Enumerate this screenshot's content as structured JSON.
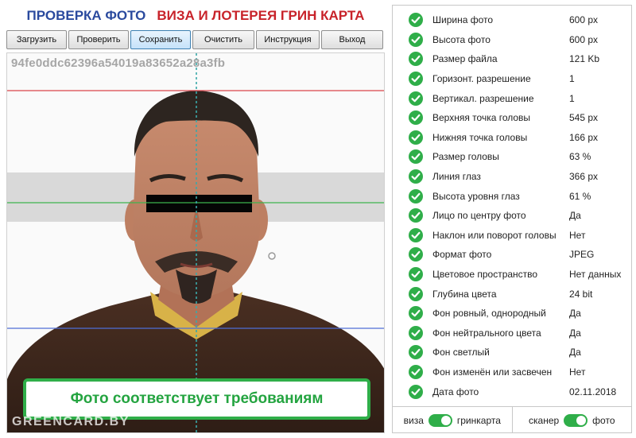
{
  "header": {
    "title_left": "ПРОВЕРКА ФОТО",
    "title_right": "ВИЗА И ЛОТЕРЕЯ ГРИН КАРТА"
  },
  "toolbar": {
    "buttons": [
      {
        "label": "Загрузить"
      },
      {
        "label": "Проверить"
      },
      {
        "label": "Сохранить"
      },
      {
        "label": "Очистить"
      },
      {
        "label": "Инструкция"
      },
      {
        "label": "Выход"
      }
    ],
    "active_index": 2
  },
  "photo": {
    "file_hash": "94fe0ddc62396a54019a83652a28a3fb",
    "verdict": "Фото соответствует требованиям",
    "watermark": "GREENCARD.BY"
  },
  "checks": [
    {
      "label": "Ширина фото",
      "value": "600 px"
    },
    {
      "label": "Высота фото",
      "value": "600 px"
    },
    {
      "label": "Размер файла",
      "value": "121 Kb"
    },
    {
      "label": "Горизонт. разрешение",
      "value": "1"
    },
    {
      "label": "Вертикал. разрешение",
      "value": "1"
    },
    {
      "label": "Верхняя точка головы",
      "value": "545 px"
    },
    {
      "label": "Нижняя точка головы",
      "value": "166 px"
    },
    {
      "label": "Размер головы",
      "value": "63 %"
    },
    {
      "label": "Линия глаз",
      "value": "366 px"
    },
    {
      "label": "Высота уровня глаз",
      "value": "61 %"
    },
    {
      "label": "Лицо по центру фото",
      "value": "Да"
    },
    {
      "label": "Наклон или поворот головы",
      "value": "Нет"
    },
    {
      "label": "Формат фото",
      "value": "JPEG"
    },
    {
      "label": "Цветовое пространство",
      "value": "Нет данных"
    },
    {
      "label": "Глубина цвета",
      "value": "24 bit"
    },
    {
      "label": "Фон ровный, однородный",
      "value": "Да"
    },
    {
      "label": "Фон нейтрального цвета",
      "value": "Да"
    },
    {
      "label": "Фон светлый",
      "value": "Да"
    },
    {
      "label": "Фон изменён или засвечен",
      "value": "Нет"
    },
    {
      "label": "Дата фото",
      "value": "02.11.2018"
    }
  ],
  "modes": {
    "purpose": {
      "left": "виза",
      "right": "гринкарта",
      "selected": "гринкарта"
    },
    "source": {
      "left": "сканер",
      "right": "фото",
      "selected": "фото"
    }
  },
  "colors": {
    "check_green": "#2fae49",
    "title_blue": "#2a4a9e",
    "title_red": "#c8232a",
    "top_guide": "#d9434a",
    "eye_guide": "#3fb54e",
    "chin_guide": "#4f6ed6",
    "center_guide": "#3aa9a9"
  }
}
